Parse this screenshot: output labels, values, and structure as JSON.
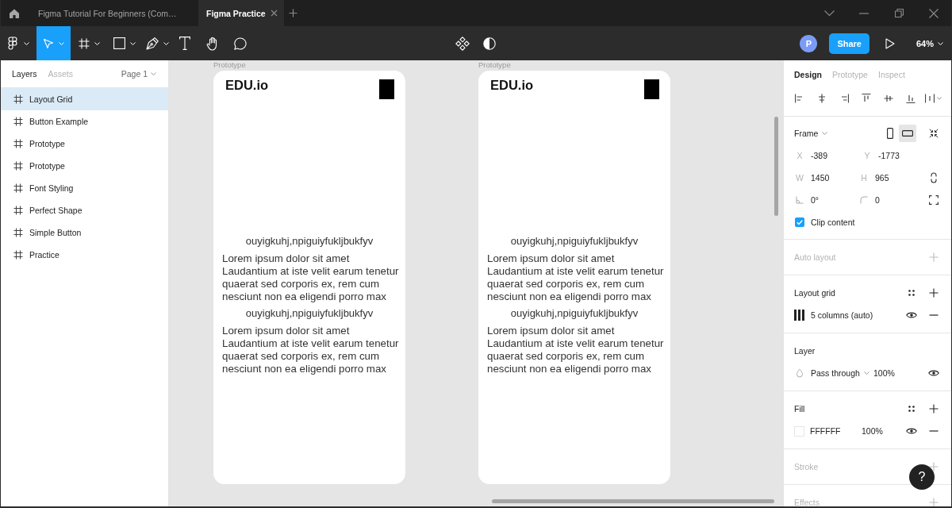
{
  "title_bar": {
    "tabs": [
      {
        "label": "Figma Tutorial For Beginners (Com…",
        "selected": false
      },
      {
        "label": "Figma Practice",
        "selected": true
      }
    ]
  },
  "toolbar": {
    "tools": [
      {
        "kind": "main-menu",
        "selected": false,
        "caret": true
      },
      {
        "kind": "move",
        "selected": true,
        "caret": true
      },
      {
        "kind": "frame",
        "selected": false,
        "caret": true
      },
      {
        "kind": "shape",
        "selected": false,
        "caret": true
      },
      {
        "kind": "pen",
        "selected": false,
        "caret": true
      },
      {
        "kind": "text",
        "selected": false,
        "caret": false
      },
      {
        "kind": "hand",
        "selected": false,
        "caret": false
      },
      {
        "kind": "comment",
        "selected": false,
        "caret": false
      }
    ],
    "avatar": "P",
    "share": "Share",
    "zoom": "64%"
  },
  "layers_panel": {
    "tabs": [
      {
        "label": "Layers",
        "selected": true
      },
      {
        "label": "Assets",
        "selected": false
      }
    ],
    "page": "Page 1",
    "layers": [
      {
        "name": "Layout Grid",
        "selected": true
      },
      {
        "name": "Button Example",
        "selected": false
      },
      {
        "name": "Prototype",
        "selected": false
      },
      {
        "name": "Prototype",
        "selected": false
      },
      {
        "name": "Font Styling",
        "selected": false
      },
      {
        "name": "Perfect Shape",
        "selected": false
      },
      {
        "name": "Simple Button",
        "selected": false
      },
      {
        "name": "Practice",
        "selected": false
      }
    ]
  },
  "canvas": {
    "frames": [
      {
        "label": "Prototype",
        "logo": "EDU.io",
        "blocks": [
          {
            "heading": "ouyigkuhj,npiguiyfukljbukfyv",
            "lines": [
              "Lorem ipsum dolor sit amet",
              "Laudantium at iste velit earum tenetur",
              "quaerat sed corporis ex, rem cum",
              "nesciunt non ea eligendi porro max"
            ]
          },
          {
            "heading": "ouyigkuhj,npiguiyfukljbukfyv",
            "lines": [
              "Lorem ipsum dolor sit amet",
              "Laudantium at iste velit earum tenetur",
              "quaerat sed corporis ex, rem cum",
              "nesciunt non ea eligendi porro max"
            ]
          }
        ]
      },
      {
        "label": "Prototype",
        "logo": "EDU.io",
        "blocks": [
          {
            "heading": "ouyigkuhj,npiguiyfukljbukfyv",
            "lines": [
              "Lorem ipsum dolor sit amet",
              "Laudantium at iste velit earum tenetur",
              "quaerat sed corporis ex, rem cum",
              "nesciunt non ea eligendi porro max"
            ]
          },
          {
            "heading": "ouyigkuhj,npiguiyfukljbukfyv",
            "lines": [
              "Lorem ipsum dolor sit amet",
              "Laudantium at iste velit earum tenetur",
              "quaerat sed corporis ex, rem cum",
              "nesciunt non ea eligendi porro max"
            ]
          }
        ]
      }
    ]
  },
  "design_panel": {
    "tabs": [
      {
        "label": "Design",
        "selected": true
      },
      {
        "label": "Prototype",
        "selected": false
      },
      {
        "label": "Inspect",
        "selected": false
      }
    ],
    "frame": {
      "title": "Frame",
      "orientations": [
        {
          "kind": "portrait",
          "selected": false
        },
        {
          "kind": "landscape",
          "selected": true
        }
      ],
      "fields": [
        {
          "label": "X",
          "value": "-389"
        },
        {
          "label": "Y",
          "value": "-1773"
        },
        {
          "label": "W",
          "value": "1450"
        },
        {
          "label": "H",
          "value": "965"
        }
      ],
      "rotation": "0°",
      "corner_radius": "0",
      "clip_content": {
        "label": "Clip content",
        "checked": true
      }
    },
    "sections": [
      {
        "kind": "auto_layout",
        "title": "Auto layout",
        "active": false
      },
      {
        "kind": "layout_grid",
        "title": "Layout grid",
        "active": true,
        "grids": [
          {
            "label": "5 columns (auto)"
          }
        ]
      },
      {
        "kind": "layer",
        "title": "Layer",
        "active": true,
        "blend_mode": "Pass through",
        "opacity": "100%"
      },
      {
        "kind": "fill",
        "title": "Fill",
        "active": true,
        "fills": [
          {
            "hex": "FFFFFF",
            "opacity": "100%"
          }
        ]
      },
      {
        "kind": "stroke",
        "title": "Stroke",
        "active": false
      },
      {
        "kind": "effects",
        "title": "Effects",
        "active": false
      }
    ],
    "help": "?"
  }
}
